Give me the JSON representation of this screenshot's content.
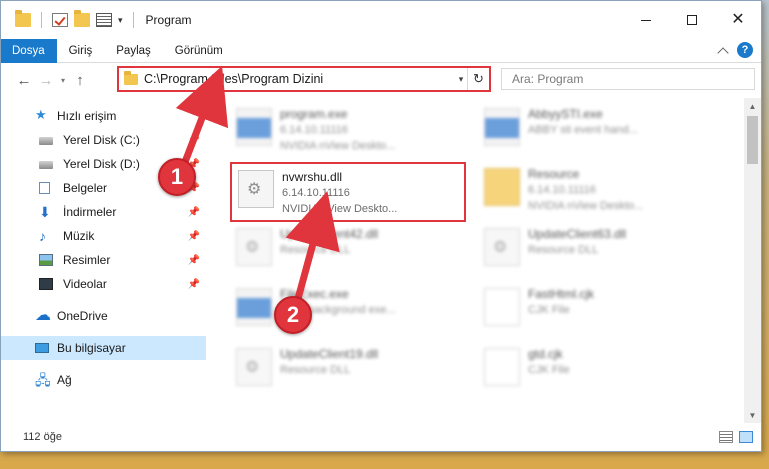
{
  "window": {
    "title": "Program"
  },
  "ribbon": {
    "tabs": [
      {
        "label": "Dosya"
      },
      {
        "label": "Giriş"
      },
      {
        "label": "Paylaş"
      },
      {
        "label": "Görünüm"
      }
    ],
    "help_label": "?"
  },
  "address": {
    "path": "C:\\Program Files\\Program Dizini",
    "search_placeholder": "Ara: Program"
  },
  "nav": {
    "items": [
      {
        "label": "Hızlı erişim",
        "icon": "star-icon"
      },
      {
        "label": "Yerel Disk (C:)",
        "icon": "drive-icon",
        "pinned": true
      },
      {
        "label": "Yerel Disk (D:)",
        "icon": "drive-icon",
        "pinned": true
      },
      {
        "label": "Belgeler",
        "icon": "document-icon",
        "pinned": true
      },
      {
        "label": "İndirmeler",
        "icon": "download-icon",
        "pinned": true
      },
      {
        "label": "Müzik",
        "icon": "music-icon",
        "pinned": true
      },
      {
        "label": "Resimler",
        "icon": "pictures-icon",
        "pinned": true
      },
      {
        "label": "Videolar",
        "icon": "video-icon",
        "pinned": true
      },
      {
        "label": "OneDrive",
        "icon": "cloud-icon"
      },
      {
        "label": "Bu bilgisayar",
        "icon": "computer-icon",
        "selected": true
      },
      {
        "label": "Ağ",
        "icon": "network-icon"
      }
    ]
  },
  "files": [
    {
      "name": "program.exe",
      "sub1": "6.14.10.11116",
      "sub2": "NVIDIA nView Deskto...",
      "icon": "app-file-icon"
    },
    {
      "name": "AbbyySTI.exe",
      "sub1": "ABBY sti event hand...",
      "sub2": "",
      "icon": "app-file-icon"
    },
    {
      "name": "nvwrshu.dll",
      "sub1": "6.14.10.11116",
      "sub2": "NVIDIA nView Deskto...",
      "icon": "dll-file-icon",
      "highlighted": true
    },
    {
      "name": "Resource",
      "sub1": "6.14.10.11116",
      "sub2": "NVIDIA nView Deskto...",
      "icon": "folder-icon"
    },
    {
      "name": "UpdateClient42.dll",
      "sub1": "Resource DLL",
      "sub2": "",
      "icon": "dll-file-icon"
    },
    {
      "name": "UpdateClient63.dll",
      "sub1": "Resource DLL",
      "sub2": "",
      "icon": "dll-file-icon"
    },
    {
      "name": "FileExec.exe",
      "sub1": "Abby background exe...",
      "sub2": "",
      "icon": "app-file-icon"
    },
    {
      "name": "FastHtml.cjk",
      "sub1": "CJK File",
      "sub2": "",
      "icon": "blank-file-icon"
    },
    {
      "name": "UpdateClient19.dll",
      "sub1": "Resource DLL",
      "sub2": "",
      "icon": "dll-file-icon"
    },
    {
      "name": "gtd.cjk",
      "sub1": "CJK File",
      "sub2": "",
      "icon": "blank-file-icon"
    }
  ],
  "status": {
    "count": "112 öğe"
  },
  "annotations": [
    {
      "number": "1"
    },
    {
      "number": "2"
    }
  ],
  "colors": {
    "accent": "#1979ca",
    "highlight": "#e0353d",
    "selected_nav": "#cce8ff"
  }
}
